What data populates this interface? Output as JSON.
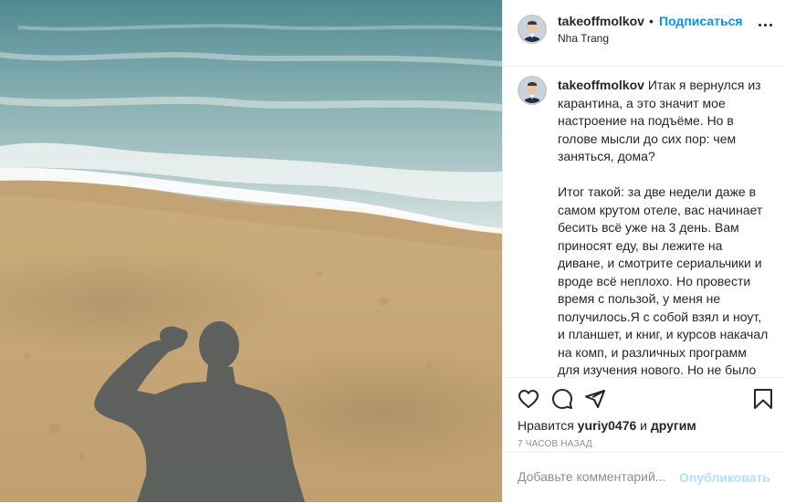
{
  "post": {
    "username": "takeoffmolkov",
    "dot": "•",
    "follow_label": "Подписаться",
    "location": "Nha Trang",
    "caption_username": "takeoffmolkov",
    "caption_text": "Итак я вернулся из карантина, а это значит мое настроение на подъёме. Но в голове мысли до сих пор: чем заняться, дома?\n\nИтог такой: за две недели даже в самом крутом отеле, вас начинает бесить всё уже на 3 день. Вам приносят еду, вы лежите на диване, и смотрите сериальчики и вроде всё неплохо. Но провести время с пользой, у меня не получилось.Я с собой взял и ноут, и планшет, и книг, и курсов накачал на комп, и различных программ для изучения нового. Но не было настроения, что-то изучать и читать, когда ты заперт в 4 стенах. В моей голове была только одна мысль, свалить"
  },
  "likes": {
    "prefix": "Нравится",
    "user": "yuriy0476",
    "suffix_prefix": "и",
    "others": "другим"
  },
  "time_ago": "7 ЧАСОВ НАЗАД",
  "comment": {
    "placeholder": "Добавьте комментарий...",
    "publish_label": "Опубликовать"
  },
  "icons": {
    "like": "heart-icon",
    "comment": "comment-icon",
    "share": "share-icon",
    "save": "bookmark-icon",
    "more": "more-options-icon"
  },
  "colors": {
    "accent": "#0095f6",
    "accent_disabled": "#b2dffc",
    "text": "#262626",
    "muted": "#8e8e8e",
    "border": "#efefef"
  }
}
